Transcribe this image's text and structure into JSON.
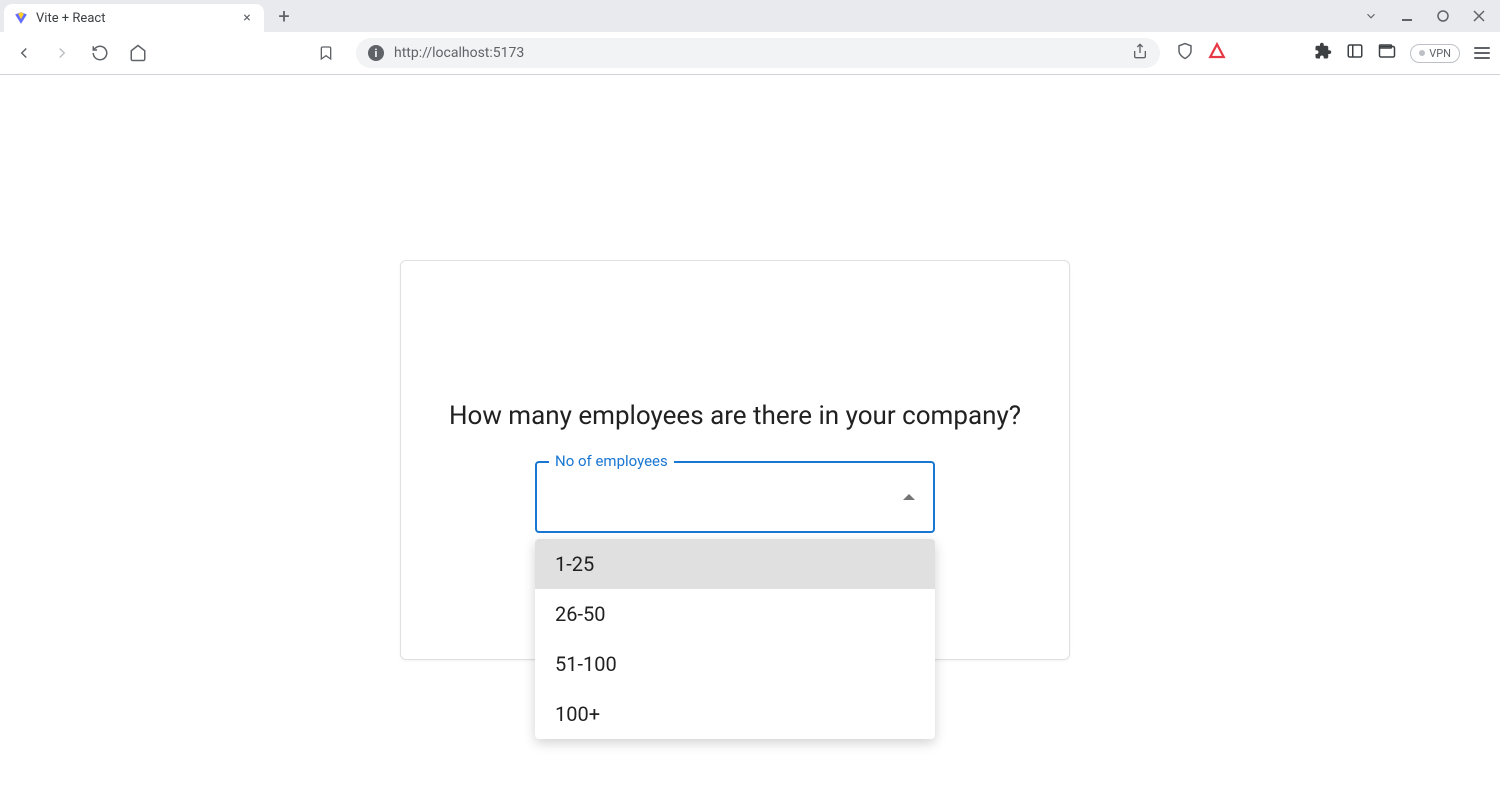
{
  "browser": {
    "tab_title": "Vite + React",
    "url": "http://localhost:5173",
    "vpn_label": "VPN"
  },
  "card": {
    "question": "How many employees are there in your company?",
    "select_label": "No of employees",
    "options": [
      "1-25",
      "26-50",
      "51-100",
      "100+"
    ]
  }
}
